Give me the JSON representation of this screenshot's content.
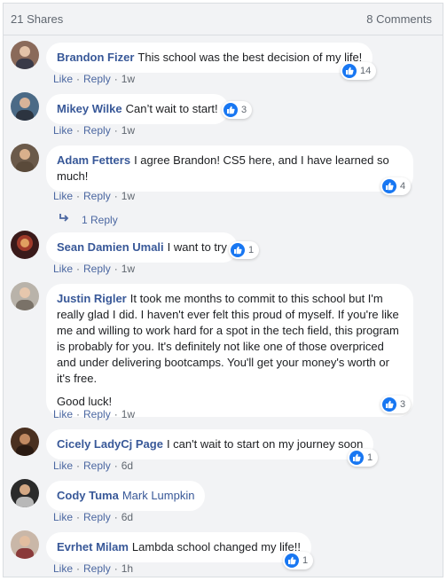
{
  "header": {
    "shares": "21 Shares",
    "comments": "8 Comments"
  },
  "colors": {
    "link": "#385898",
    "like_blue": "#1877f2",
    "background": "#f2f3f5"
  },
  "actions": {
    "like": "Like",
    "reply": "Reply",
    "separator": "·"
  },
  "comments": [
    {
      "name": "Brandon Fizer",
      "text": "This school was the best decision of my life!",
      "time": "1w",
      "likes": "14",
      "avatar_icon": "user-avatar"
    },
    {
      "name": "Mikey Wilke",
      "text": "Can’t wait to start!",
      "time": "1w",
      "likes": "3",
      "avatar_icon": "user-avatar"
    },
    {
      "name": "Adam Fetters",
      "text": "I agree Brandon! CS5 here, and I have learned so much!",
      "time": "1w",
      "likes": "4",
      "avatar_icon": "user-avatar",
      "replies": "1 Reply"
    },
    {
      "name": "Sean Damien Umali",
      "text": "I want to try",
      "time": "1w",
      "likes": "1",
      "avatar_icon": "user-avatar"
    },
    {
      "name": "Justin Rigler",
      "text": "It took me months to commit to this school but I'm really glad I did. I haven't ever felt this proud of myself. If you're like me and willing to work hard for a spot in the tech field, this program is probably for you. It's definitely not like one of those overpriced and under delivering bootcamps. You'll get your money's worth or it's free.",
      "text2": "Good luck!",
      "time": "1w",
      "likes": "3",
      "avatar_icon": "user-avatar"
    },
    {
      "name": "Cicely LadyCj Page",
      "text": "I can't wait to start on my journey soon",
      "time": "6d",
      "likes": "1",
      "avatar_icon": "user-avatar"
    },
    {
      "name": "Cody Tuma",
      "text": "Mark Lumpkin",
      "time": "6d",
      "avatar_icon": "user-avatar"
    },
    {
      "name": "Evrhet Milam",
      "text": "Lambda school changed my life!!",
      "time": "1h",
      "likes": "1",
      "avatar_icon": "user-avatar"
    }
  ]
}
